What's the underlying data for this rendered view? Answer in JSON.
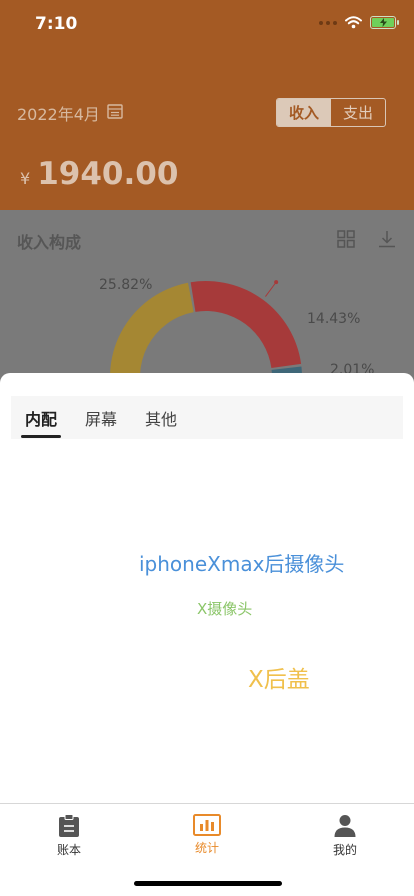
{
  "status_bar": {
    "time": "7:10"
  },
  "header": {
    "month": "2022年4月",
    "toggle": {
      "income": "收入",
      "expense": "支出",
      "selected": "收入"
    },
    "currency": "¥",
    "amount": "1940.00"
  },
  "stats": {
    "title": "收入构成",
    "chart_data": {
      "type": "pie",
      "slices": [
        {
          "label": "25.82%",
          "value": 25.82,
          "color": "#a63a3a"
        },
        {
          "label": "14.43%",
          "value": 14.43,
          "color": "#3f6778"
        },
        {
          "label": "2.01%",
          "value": 2.01,
          "color": "#2f4a55"
        },
        {
          "value": 57.74,
          "color": "#a58733"
        }
      ]
    }
  },
  "sheet": {
    "tabs": [
      {
        "label": "内配",
        "active": true
      },
      {
        "label": "屏幕",
        "active": false
      },
      {
        "label": "其他",
        "active": false
      }
    ],
    "word_cloud": [
      {
        "text": "iphoneXmax后摄像头",
        "color": "#4a90d9"
      },
      {
        "text": "X摄像头",
        "color": "#8cc66a"
      },
      {
        "text": "X后盖",
        "color": "#f0c04c"
      }
    ]
  },
  "tabbar": {
    "items": [
      {
        "label": "账本",
        "icon": "clipboard-icon"
      },
      {
        "label": "统计",
        "icon": "chart-icon",
        "active": true
      },
      {
        "label": "我的",
        "icon": "person-icon"
      }
    ]
  },
  "colors": {
    "header": "#a45a24",
    "accent": "#e88a2a",
    "dim_overlay": "#7a7a7a"
  }
}
